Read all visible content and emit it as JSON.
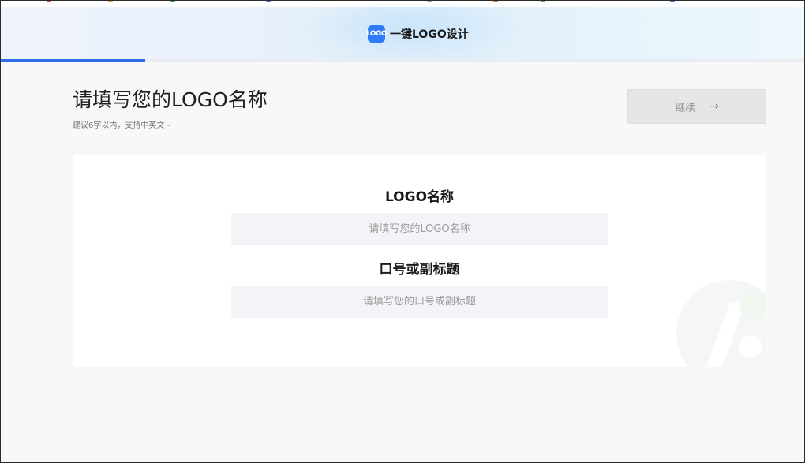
{
  "colors": {
    "accent": "#2f6ee6",
    "brand_logo": "#2f7cf6",
    "button_disabled_bg": "#e6e6e6",
    "input_bg": "#f2f4f7"
  },
  "header": {
    "logo_icon": "logo-badge-icon",
    "logo_mark": "LOGO",
    "title": "一键LOGO设计"
  },
  "progress": {
    "value": 0.18
  },
  "step": {
    "title": "请填写您的LOGO名称",
    "subtitle": "建议6字以内，支持中英文~",
    "continue_label": "继续",
    "continue_icon": "arrow-right-icon",
    "continue_arrow": "→"
  },
  "form": {
    "name_label": "LOGO名称",
    "name_value": "",
    "name_placeholder": "请填写您的LOGO名称",
    "slogan_label": "口号或副标题",
    "slogan_value": "",
    "slogan_placeholder": "请填写您的口号或副标题"
  }
}
